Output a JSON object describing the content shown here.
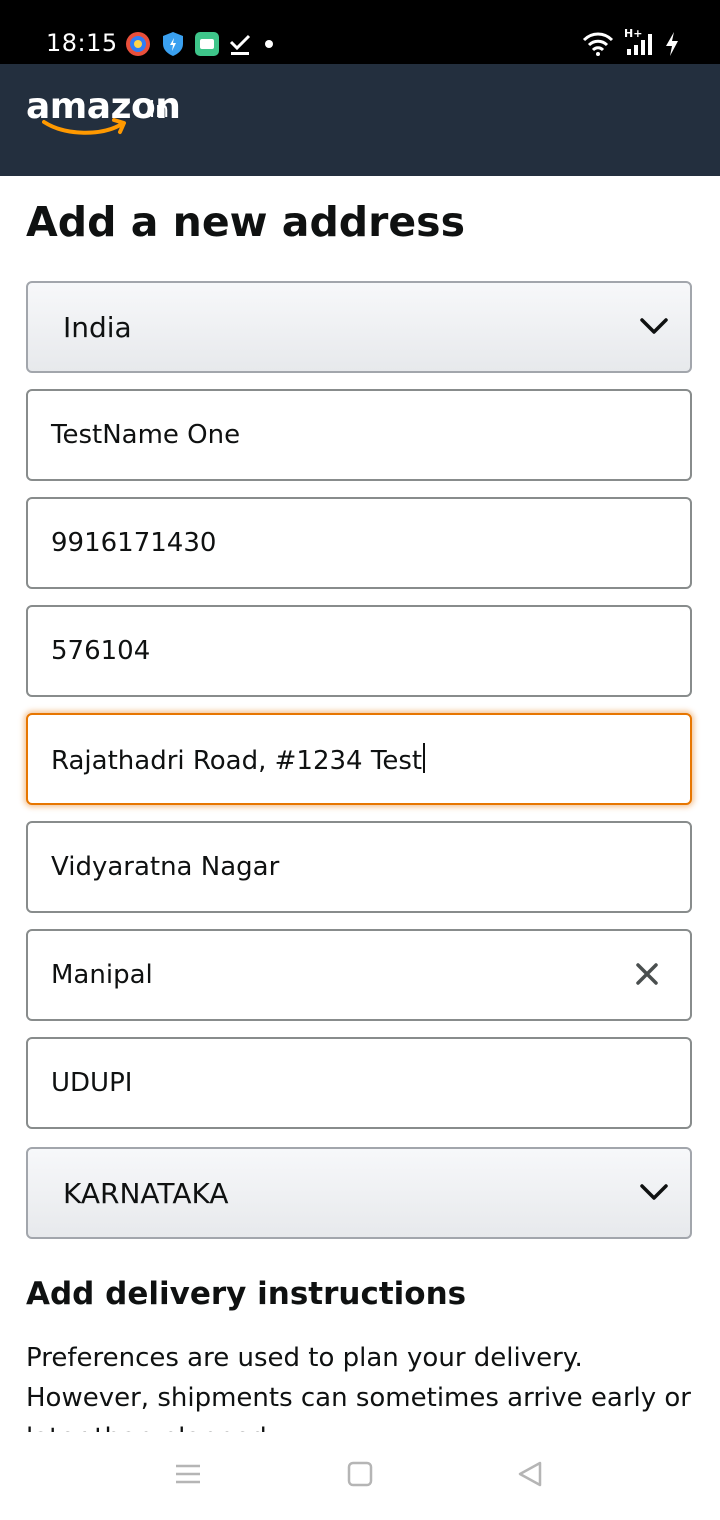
{
  "status_bar": {
    "time": "18:15",
    "left_icons": [
      "browser-app-icon",
      "shield-app-icon",
      "message-app-icon",
      "check-download-icon",
      "dot-icon"
    ],
    "right_icons": [
      "wifi-icon",
      "signal-icon",
      "charging-bolt-icon"
    ],
    "network_label": "H+"
  },
  "header": {
    "logo_text": "amazon",
    "logo_suffix": ".in",
    "background": "#232f3e",
    "smile_color": "#ff9900"
  },
  "form": {
    "title": "Add a new address",
    "country": "India",
    "full_name": "TestName One",
    "mobile": "9916171430",
    "pincode": "576104",
    "address_line1": "Rajathadri Road, #1234 Test",
    "address_line2": "Vidyaratna Nagar",
    "landmark": "Manipal",
    "city": "UDUPI",
    "state": "KARNATAKA",
    "focus_color": "#e77600"
  },
  "delivery": {
    "title": "Add delivery instructions",
    "text": "Preferences are used to plan your delivery. However, shipments can sometimes arrive early or later than planned."
  },
  "nav": {
    "buttons": [
      "menu-icon",
      "home-square-icon",
      "back-triangle-icon"
    ]
  }
}
